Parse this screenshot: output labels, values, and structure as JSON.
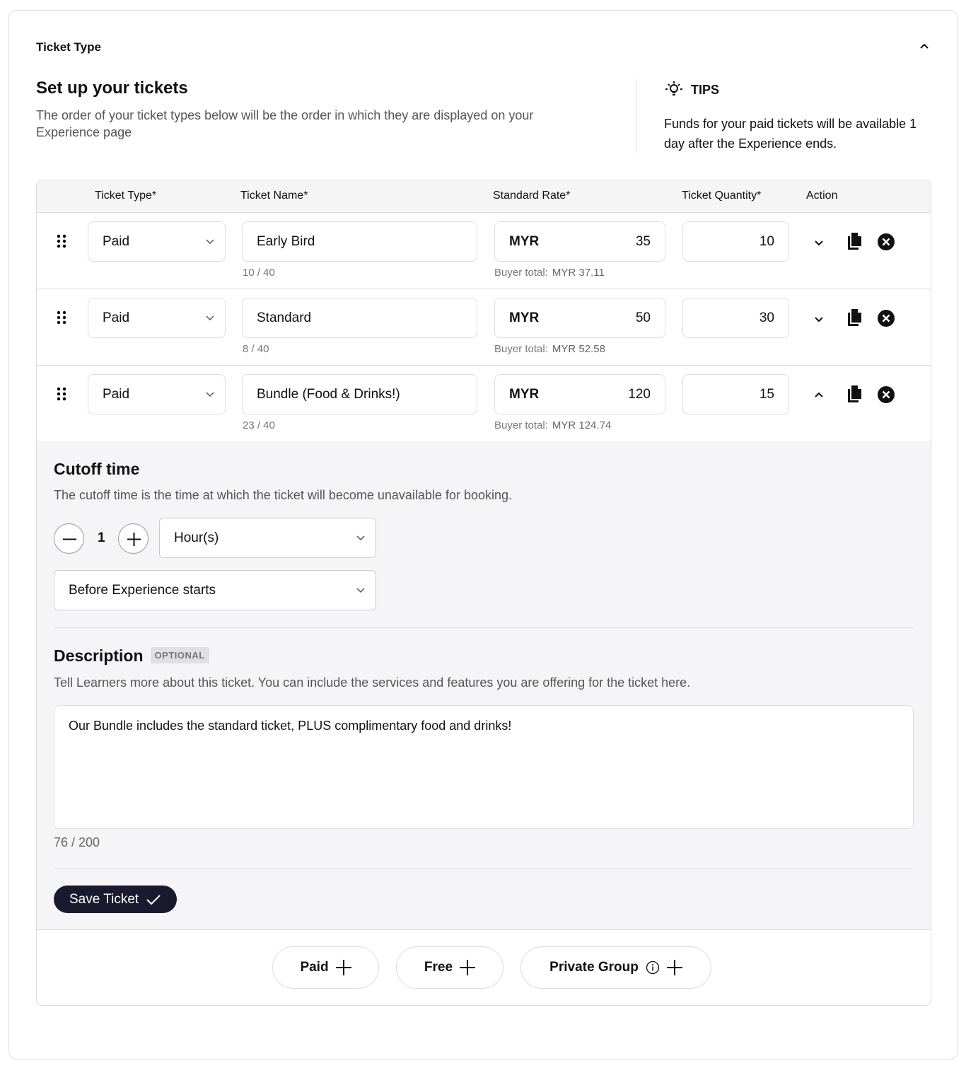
{
  "section_title": "Ticket Type",
  "heading": "Set up your tickets",
  "description": "The order of your ticket types below will be the order in which they are displayed on your Experience page",
  "tips": {
    "label": "TIPS",
    "text": "Funds for your paid tickets will be available 1 day after the Experience ends."
  },
  "table": {
    "headers": {
      "type": "Ticket Type*",
      "name": "Ticket Name*",
      "rate": "Standard Rate*",
      "quantity": "Ticket Quantity*",
      "action": "Action"
    },
    "rows": [
      {
        "type": "Paid",
        "name": "Early Bird",
        "name_count": "10 / 40",
        "currency": "MYR",
        "rate": "35",
        "buyer_total_label": "Buyer total:",
        "buyer_total": "MYR 37.11",
        "quantity": "10",
        "expanded": false
      },
      {
        "type": "Paid",
        "name": "Standard",
        "name_count": "8 / 40",
        "currency": "MYR",
        "rate": "50",
        "buyer_total_label": "Buyer total:",
        "buyer_total": "MYR 52.58",
        "quantity": "30",
        "expanded": false
      },
      {
        "type": "Paid",
        "name": "Bundle (Food & Drinks!)",
        "name_count": "23 / 40",
        "currency": "MYR",
        "rate": "120",
        "buyer_total_label": "Buyer total:",
        "buyer_total": "MYR 124.74",
        "quantity": "15",
        "expanded": true
      }
    ]
  },
  "cutoff": {
    "title": "Cutoff time",
    "description": "The cutoff time is the time at which the ticket will become unavailable for booking.",
    "value": "1",
    "unit": "Hour(s)",
    "relative": "Before Experience starts"
  },
  "ticket_description": {
    "title": "Description",
    "badge": "OPTIONAL",
    "help": "Tell Learners more about this ticket. You can include the services and features you are offering for the ticket here.",
    "value": "Our Bundle includes the standard ticket, PLUS complimentary food and drinks!",
    "count": "76 / 200"
  },
  "save_label": "Save Ticket",
  "add_buttons": {
    "paid": "Paid",
    "free": "Free",
    "private_group": "Private Group"
  }
}
